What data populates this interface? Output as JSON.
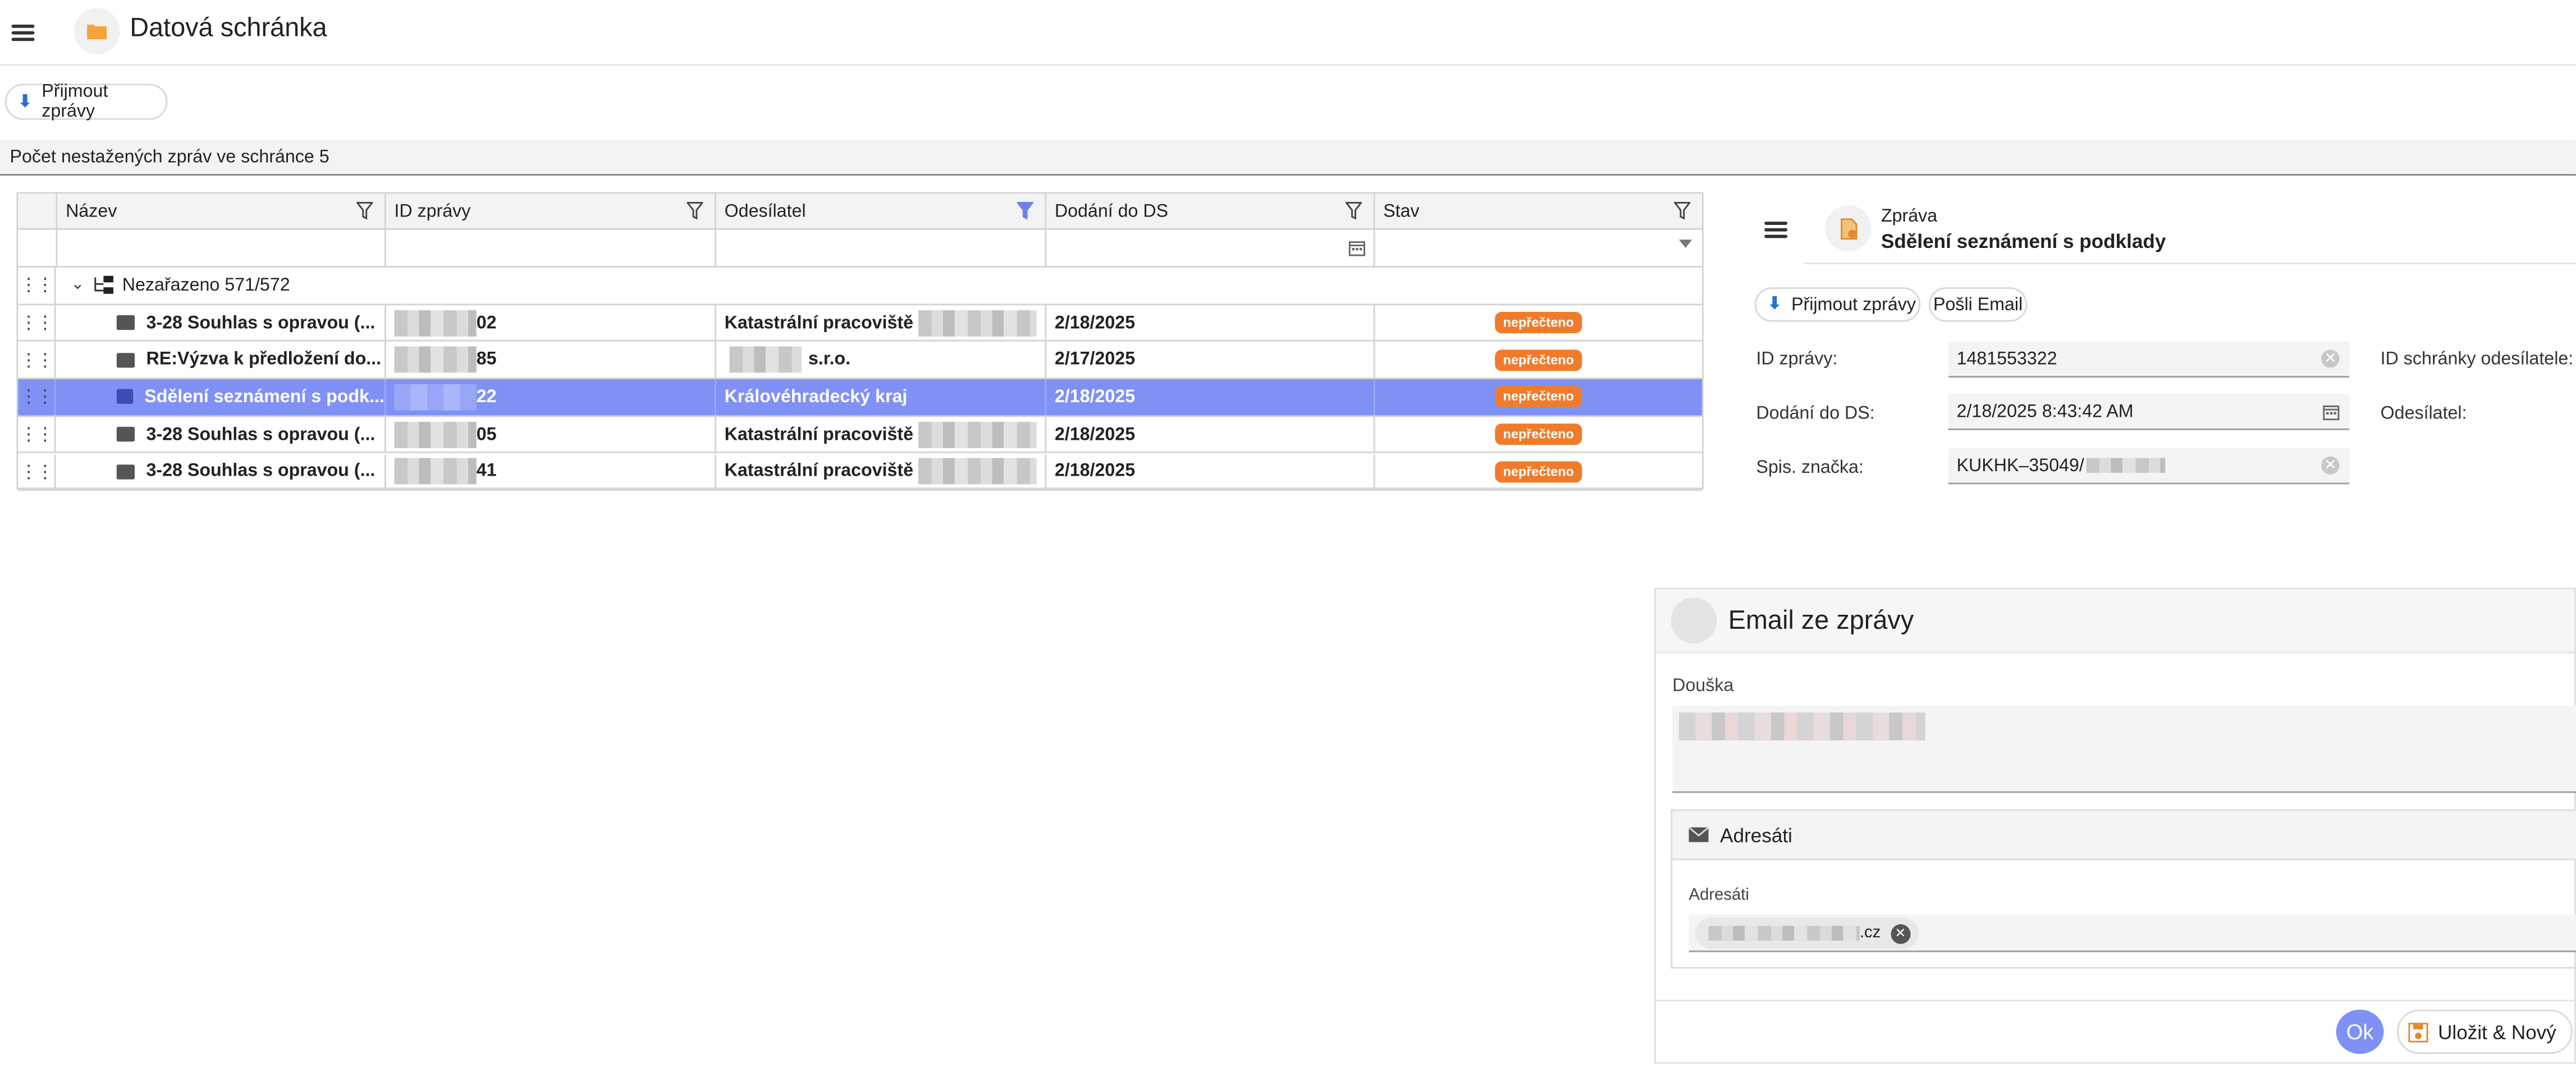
{
  "app": {
    "title": "Datová schránka"
  },
  "toolbar": {
    "receive_label": "Přijmout zprávy"
  },
  "info_bar": {
    "text": "Počet nestažených zpráv ve schránce 5"
  },
  "grid": {
    "columns": [
      "Název",
      "ID zprávy",
      "Odesílatel",
      "Dodání do DS",
      "Stav"
    ],
    "group_label": "Nezařazeno 571/572",
    "rows": [
      {
        "name": "3-28 Souhlas s opravou (...",
        "id_suffix": "02",
        "sender": "Katastrální pracoviště",
        "sender_suffix": "",
        "date": "2/18/2025",
        "status": "nepřečteno",
        "selected": false
      },
      {
        "name": "RE:Výzva k předložení do...",
        "id_suffix": "85",
        "sender": "",
        "sender_suffix": "s.r.o.",
        "date": "2/17/2025",
        "status": "nepřečteno",
        "selected": false
      },
      {
        "name": "Sdělení seznámení s podk...",
        "id_suffix": "22",
        "sender": "Královéhradecký kraj",
        "sender_suffix": "",
        "date": "2/18/2025",
        "status": "nepřečteno",
        "selected": true
      },
      {
        "name": "3-28 Souhlas s opravou (...",
        "id_suffix": "05",
        "sender": "Katastrální pracoviště",
        "sender_suffix": "",
        "date": "2/18/2025",
        "status": "nepřečteno",
        "selected": false
      },
      {
        "name": "3-28 Souhlas s opravou (...",
        "id_suffix": "41",
        "sender": "Katastrální pracoviště",
        "sender_suffix": "",
        "date": "2/18/2025",
        "status": "nepřečteno",
        "selected": false
      }
    ]
  },
  "detail": {
    "kind": "Zpráva",
    "title": "Sdělení seznámení s podklady",
    "receive_label": "Přijmout zprávy",
    "email_label": "Pošli Email",
    "id_label": "ID zprávy:",
    "id_value": "1481553322",
    "delivery_label": "Dodání do DS:",
    "delivery_value": "2/18/2025 8:43:42 AM",
    "ref_label": "Spis. značka:",
    "ref_value": "KUKHK–35049/",
    "sender_box_label": "ID schránky odesílatele:",
    "sender_label": "Odesílatel:"
  },
  "email_dialog": {
    "title": "Email ze zprávy",
    "note_label": "Douška",
    "recipients_section": "Adresáti",
    "recipients_label": "Adresáti",
    "recipient_chip_suffix": ".cz",
    "ok_label": "Ok",
    "save_new_label": "Uložit & Nový"
  },
  "colors": {
    "selected_row": "#7f91f5",
    "badge": "#f07c2b",
    "accent": "#2a6fc9",
    "ok_button": "#7f91f5",
    "folder": "#f3a53a"
  }
}
